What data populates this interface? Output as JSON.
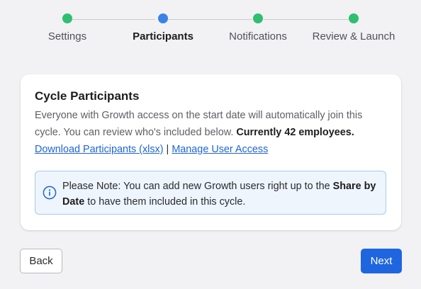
{
  "colors": {
    "step_complete": "#2fbf71",
    "step_active": "#3b82e6",
    "link": "#1f65d6",
    "primary_button": "#1f65e0",
    "note_background": "#eef5fd",
    "note_border": "#a9c9ef"
  },
  "stepper": {
    "steps": [
      {
        "label": "Settings",
        "state": "complete"
      },
      {
        "label": "Participants",
        "state": "active"
      },
      {
        "label": "Notifications",
        "state": "complete"
      },
      {
        "label": "Review & Launch",
        "state": "complete"
      }
    ]
  },
  "card": {
    "title": "Cycle Participants",
    "description": "Everyone with Growth access on the start date will automatically join this cycle. You can review who's included below. ",
    "description_bold": "Currently 42 employees.",
    "download_link": "Download Participants (xlsx)",
    "link_separator": " | ",
    "manage_link": "Manage User Access",
    "note": {
      "icon": "info-icon",
      "text_before": "Please Note: You can add new Growth users right up to the ",
      "text_bold": "Share by Date",
      "text_after": " to have them included in this cycle."
    }
  },
  "footer": {
    "back_label": "Back",
    "next_label": "Next"
  }
}
